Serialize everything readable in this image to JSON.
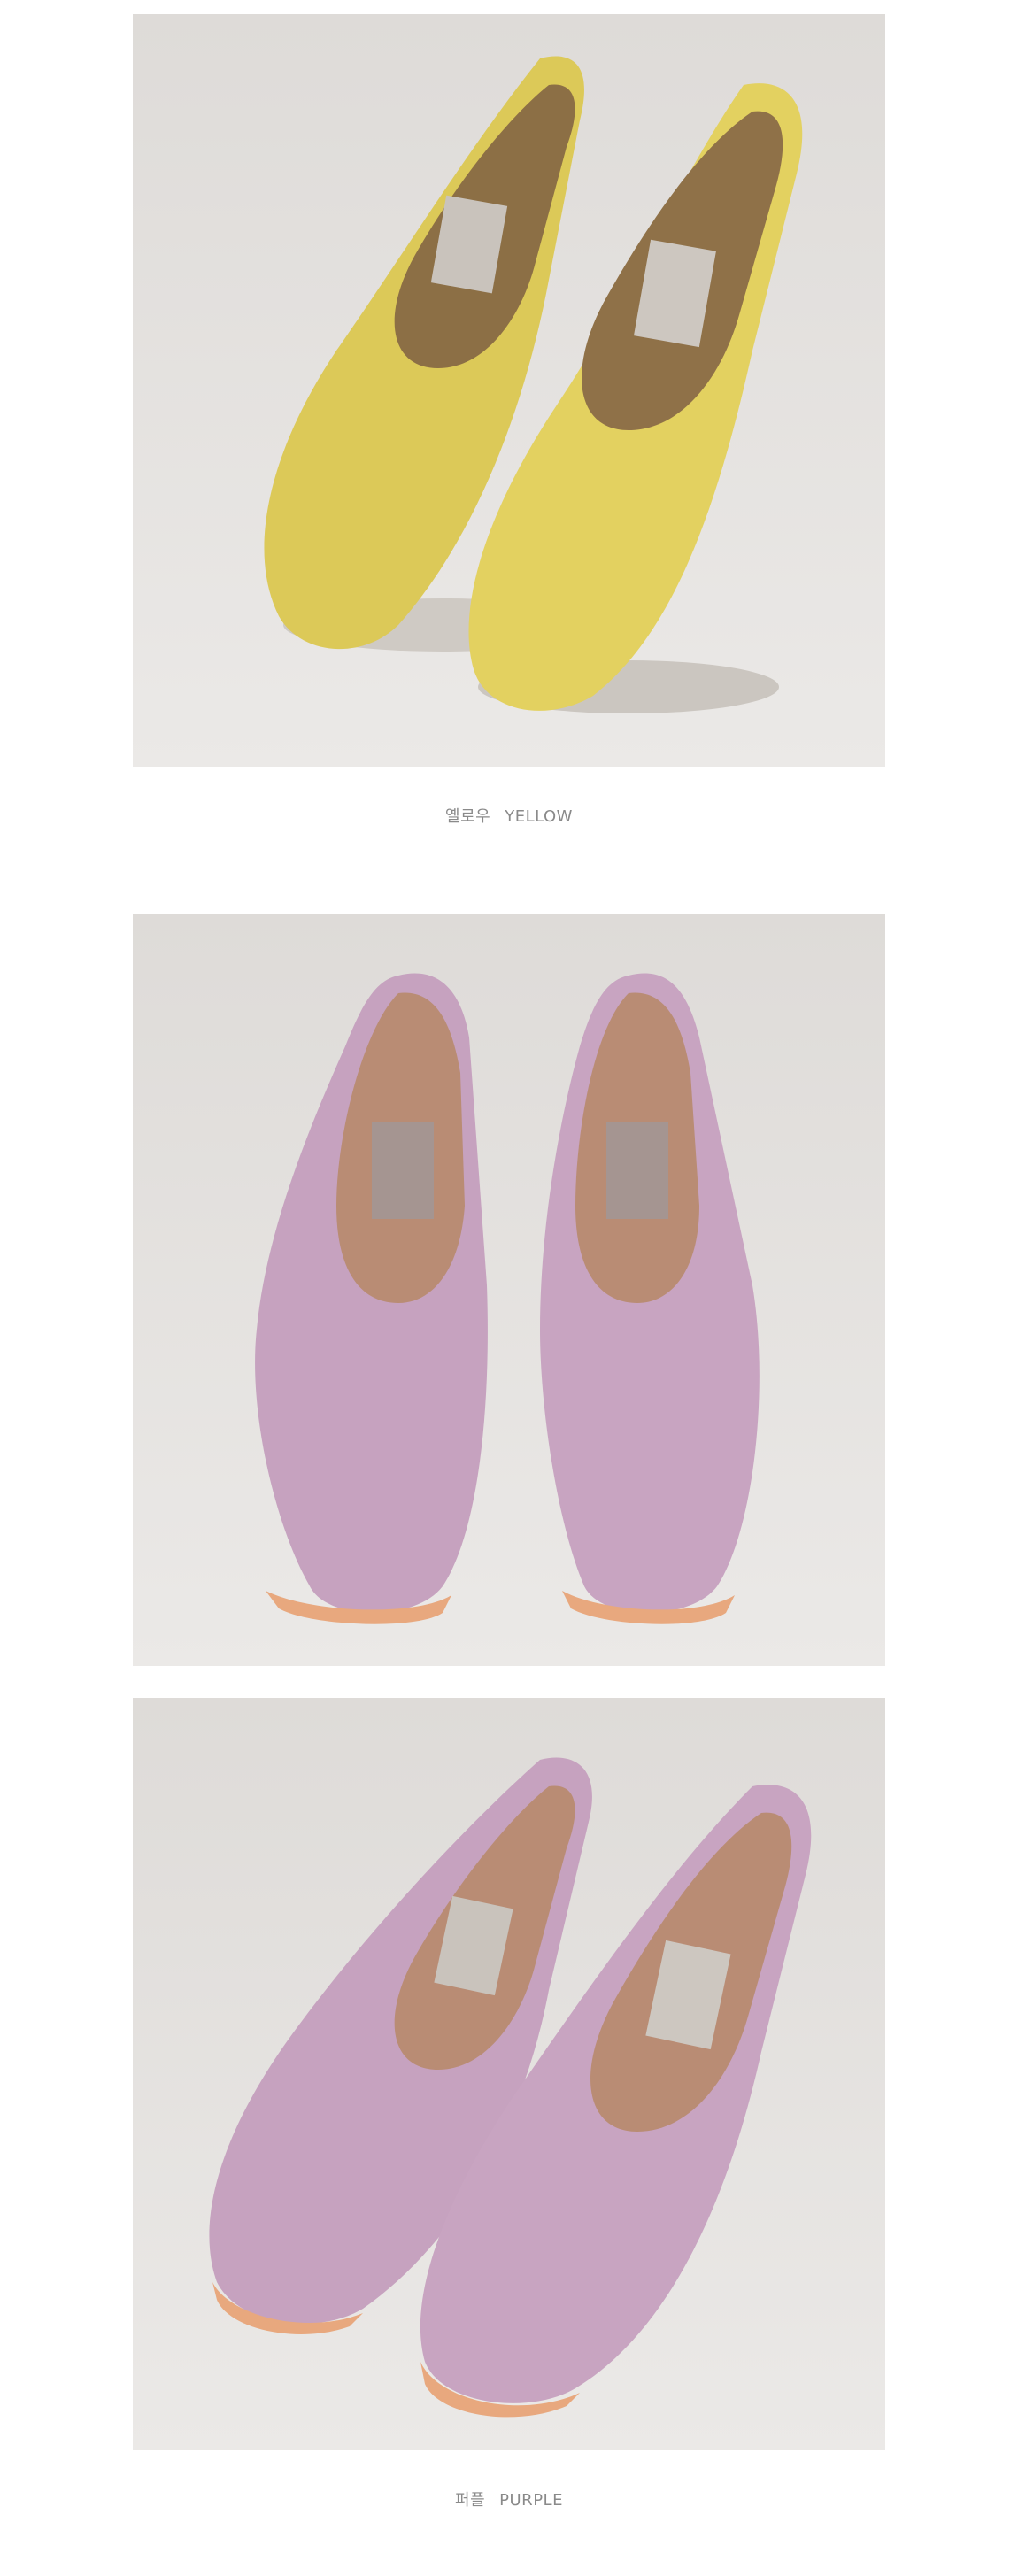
{
  "products": [
    {
      "color_kr": "옐로우",
      "color_en": "YELLOW",
      "shoe_color": "#e3d160",
      "shoe_shade": "#c9b648",
      "lining": "#8f7148"
    },
    {
      "color_kr": "퍼플",
      "color_en": "PURPLE",
      "shoe_color": "#c8a4c1",
      "shoe_shade": "#ab87a5",
      "lining": "#b98c74"
    }
  ]
}
